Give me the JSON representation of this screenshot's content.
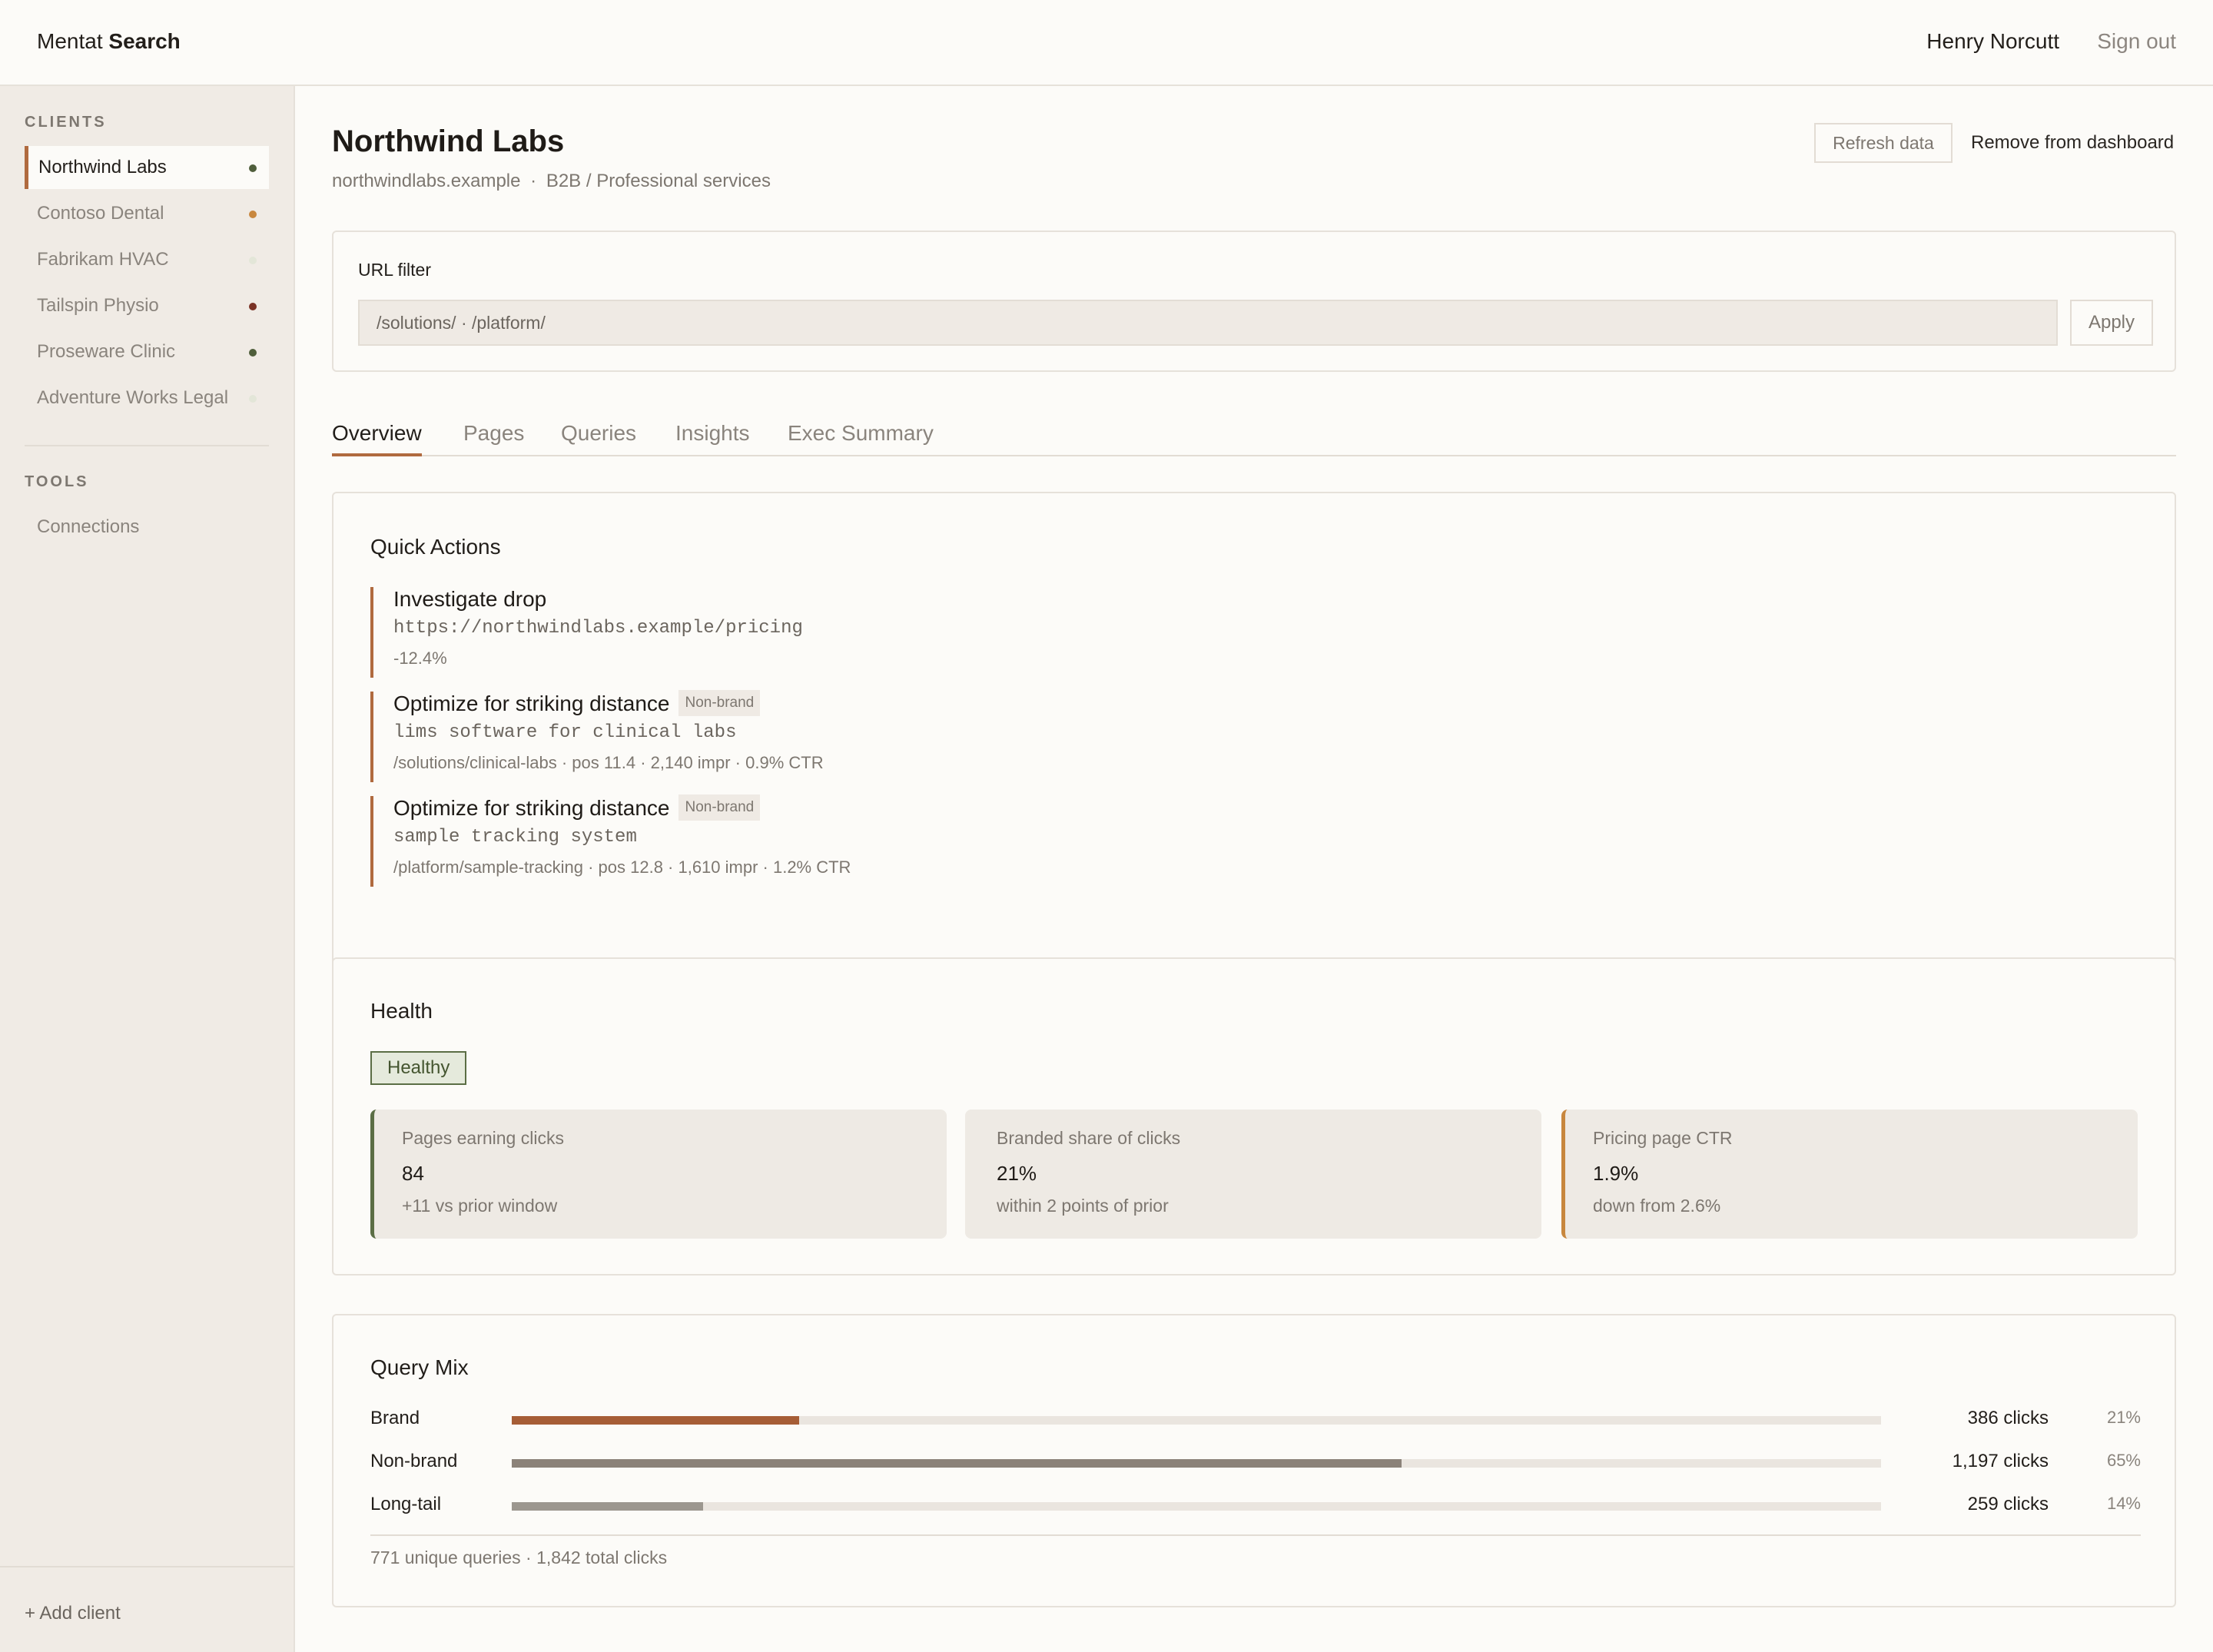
{
  "app": {
    "name_light": "Mentat",
    "name_bold": "Search"
  },
  "header": {
    "user_name": "Henry Norcutt",
    "sign_out": "Sign out"
  },
  "sidebar": {
    "clients_heading": "CLIENTS",
    "clients": [
      {
        "label": "Northwind Labs",
        "status_color": "#4f5e3b",
        "active": true
      },
      {
        "label": "Contoso Dental",
        "status_color": "#c8873e",
        "active": false
      },
      {
        "label": "Fabrikam HVAC",
        "status_color": "#e3e6d8",
        "active": false
      },
      {
        "label": "Tailspin Physio",
        "status_color": "#7a3225",
        "active": false
      },
      {
        "label": "Proseware Clinic",
        "status_color": "#4f5e3b",
        "active": false
      },
      {
        "label": "Adventure Works Legal",
        "status_color": "#e3e6d8",
        "active": false
      }
    ],
    "tools_heading": "TOOLS",
    "tools": [
      {
        "label": "Connections"
      }
    ],
    "add_client": "+ Add client"
  },
  "client": {
    "title": "Northwind Labs",
    "domain": "northwindlabs.example",
    "separator": "·",
    "industry": "B2B / Professional services",
    "refresh_label": "Refresh data",
    "remove_label": "Remove from dashboard"
  },
  "url_filter": {
    "label": "URL filter",
    "value": "/solutions/  ·  /platform/",
    "apply_label": "Apply"
  },
  "tabs": [
    {
      "label": "Overview",
      "active": true
    },
    {
      "label": "Pages",
      "active": false
    },
    {
      "label": "Queries",
      "active": false
    },
    {
      "label": "Insights",
      "active": false
    },
    {
      "label": "Exec Summary",
      "active": false
    }
  ],
  "quick_actions": {
    "title": "Quick Actions",
    "items": [
      {
        "title": "Investigate drop",
        "tag": "",
        "mono": "https://northwindlabs.example/pricing",
        "meta": "-12.4%"
      },
      {
        "title": "Optimize for striking distance",
        "tag": "Non-brand",
        "mono": "lims software for clinical labs",
        "meta": "/solutions/clinical-labs · pos 11.4 · 2,140 impr · 0.9% CTR"
      },
      {
        "title": "Optimize for striking distance",
        "tag": "Non-brand",
        "mono": "sample tracking system",
        "meta": "/platform/sample-tracking · pos 12.8 · 1,610 impr · 1.2% CTR"
      }
    ]
  },
  "health": {
    "title": "Health",
    "status": "Healthy",
    "metrics": [
      {
        "label": "Pages earning clicks",
        "value": "84",
        "note": "+11 vs prior window",
        "accent": "#5b6e45"
      },
      {
        "label": "Branded share of clicks",
        "value": "21%",
        "note": "within 2 points of prior",
        "accent": "#eeeae4"
      },
      {
        "label": "Pricing page CTR",
        "value": "1.9%",
        "note": "down from 2.6%",
        "accent": "#c8873e"
      }
    ]
  },
  "query_mix": {
    "title": "Query Mix",
    "rows": [
      {
        "label": "Brand",
        "clicks": "386 clicks",
        "pct": "21%",
        "share": 0.21,
        "color": "#a65d36"
      },
      {
        "label": "Non-brand",
        "clicks": "1,197 clicks",
        "pct": "65%",
        "share": 0.65,
        "color": "#8b8279"
      },
      {
        "label": "Long-tail",
        "clicks": "259 clicks",
        "pct": "14%",
        "share": 0.14,
        "color": "#9c978f"
      }
    ],
    "footer": "771 unique queries  ·  1,842 total clicks"
  }
}
